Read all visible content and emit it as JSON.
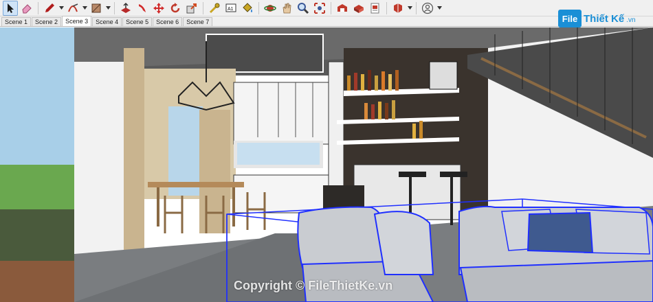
{
  "toolbar": {
    "tools": [
      {
        "name": "select-tool-icon",
        "color": "#1a1a1a"
      },
      {
        "name": "eraser-tool-icon",
        "color": "#e27aa8"
      },
      {
        "name": "pencil-line-tool-icon",
        "color": "#b01c1c"
      },
      {
        "name": "arc-tool-icon",
        "color": "#c0392b"
      },
      {
        "name": "rectangle-tool-icon",
        "color": "#8a5a3c"
      },
      {
        "name": "push-pull-tool-icon",
        "color": "#b72a2a"
      },
      {
        "name": "move-tool-icon",
        "color": "#d12b2b"
      },
      {
        "name": "rotate-tool-icon",
        "color": "#c0392b"
      },
      {
        "name": "scale-tool-icon",
        "color": "#d14a1f"
      },
      {
        "name": "tape-measure-tool-icon",
        "color": "#c9a623"
      },
      {
        "name": "text-tool-icon",
        "label": "A1"
      },
      {
        "name": "paint-bucket-tool-icon",
        "color": "#c9a623"
      },
      {
        "name": "orbit-tool-icon",
        "color": "#c0392b"
      },
      {
        "name": "pan-tool-icon",
        "color": "#d4b48a"
      },
      {
        "name": "zoom-tool-icon",
        "color": "#3b5998"
      },
      {
        "name": "zoom-extents-tool-icon",
        "color": "#c0392b"
      },
      {
        "name": "warehouse-icon",
        "color": "#c0392b"
      },
      {
        "name": "extension-warehouse-icon",
        "color": "#c0392b"
      },
      {
        "name": "send-to-layout-icon",
        "color": "#c0392b"
      },
      {
        "name": "extension-manager-icon",
        "color": "#c0392b"
      },
      {
        "name": "account-icon",
        "color": "#555555"
      }
    ]
  },
  "scenes": {
    "tabs": [
      "Scene 1",
      "Scene 2",
      "Scene 3",
      "Scene 4",
      "Scene 5",
      "Scene 6",
      "Scene 7"
    ],
    "active_index": 2
  },
  "watermark": {
    "logo_box": "File",
    "logo_text": "Thiết Kế",
    "logo_domain": ".vn",
    "copyright": "Copyright © FileThietKe.vn"
  },
  "colors": {
    "selection": "#1f2fff",
    "sofa": "#c9ccd1",
    "cushion": "#3f5a8f",
    "cabinet": "#f4f4f4",
    "wall_dark": "#3a332d",
    "floor": "#7a7d80",
    "sky": "#9ec9e6",
    "grass": "#6aa84f"
  }
}
